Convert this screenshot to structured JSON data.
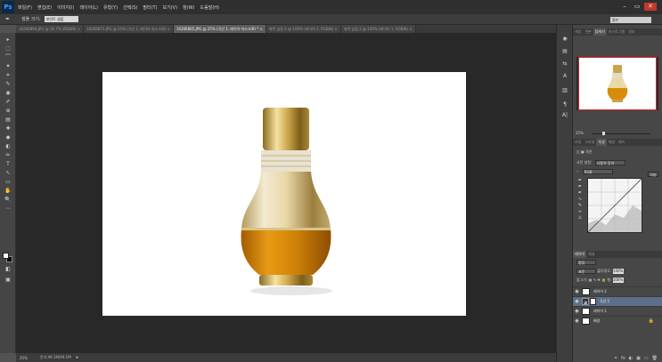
{
  "app": {
    "logo": "Ps",
    "menu": [
      "파일(F)",
      "편집(E)",
      "이미지(I)",
      "레이어(L)",
      "유형(Y)",
      "선택(S)",
      "필터(T)",
      "보기(V)",
      "창(W)",
      "도움말(H)"
    ],
    "window_buttons": [
      "–",
      "▭",
      "✕"
    ]
  },
  "options_bar": {
    "tool_glyph": "✒",
    "sample_size_label": "샘플 크기:",
    "sample_size_value": "포인트 샘플",
    "workspace": "필수"
  },
  "tabs": [
    {
      "label": "16266894.JPG @ 16.7% (RGB/8) ×",
      "active": false
    },
    {
      "label": "16266873.JPG @ 25% (곡선 1, 레이어 마스크/8) ×",
      "active": false
    },
    {
      "label": "16266865.JPG @ 25% (곡선 1, 레이어 마스크/8) * ×",
      "active": true
    },
    {
      "label": "제목 없음-1 @ 100% (레이어 1, RGB/8) ×",
      "active": false
    },
    {
      "label": "제목 없음-2 @ 100% (레이어 1, RGB/8) ×",
      "active": false
    }
  ],
  "tools": [
    "▸",
    "⬚",
    "⌒",
    "✦",
    "⌗",
    "✎",
    "◉",
    "✐",
    "⊕",
    "▤",
    "✚",
    "◆",
    "◐",
    "✏",
    "T",
    "↖",
    "▭",
    "✋",
    "🔍",
    "⋯",
    "◧",
    "▣"
  ],
  "status": {
    "zoom": "25%",
    "doc": "문서:49.1M/49.1M",
    "arrow": "▸"
  },
  "right_strip_icons": [
    "◉",
    "▤",
    "⇆",
    "A",
    "▥",
    "¶",
    "A|"
  ],
  "navigator": {
    "tabs": [
      "색상",
      "견본",
      "탐색기",
      "히스토그램",
      "정보"
    ],
    "active_tab": "탐색기",
    "zoom": "25%"
  },
  "properties": {
    "tabs": [
      "조정",
      "스타일",
      "속성",
      "채널",
      "패스"
    ],
    "active_tab": "속성",
    "header": "곡선",
    "preset_label": "사전 설정:",
    "preset_value": "사용자 정의",
    "channel_value": "RGB",
    "auto_button": "자동"
  },
  "layers": {
    "tabs": [
      "레이어",
      "채널"
    ],
    "active_tab": "레이어",
    "kind_label": "종류",
    "blend_mode": "표준",
    "opacity_label": "불투명도:",
    "opacity_value": "100%",
    "lock_label": "잠그기:",
    "fill_label": "칠:",
    "fill_value": "100%",
    "items": [
      {
        "name": "레이어 2",
        "visible": true,
        "selected": false,
        "thumb": "image"
      },
      {
        "name": "곡선 1",
        "visible": true,
        "selected": true,
        "thumb": "adjustment"
      },
      {
        "name": "레이어 1",
        "visible": true,
        "selected": false,
        "thumb": "image"
      },
      {
        "name": "배경",
        "visible": true,
        "selected": false,
        "thumb": "image",
        "locked": true
      }
    ],
    "footer_icons": [
      "⚭",
      "fx",
      "◐",
      "▣",
      "▭",
      "🗑"
    ]
  },
  "colors": {
    "bg_dark": "#282828",
    "panel": "#474747",
    "selected_layer": "#5d7089",
    "gold": "#d4b66a",
    "liquid": "#c77a05"
  }
}
